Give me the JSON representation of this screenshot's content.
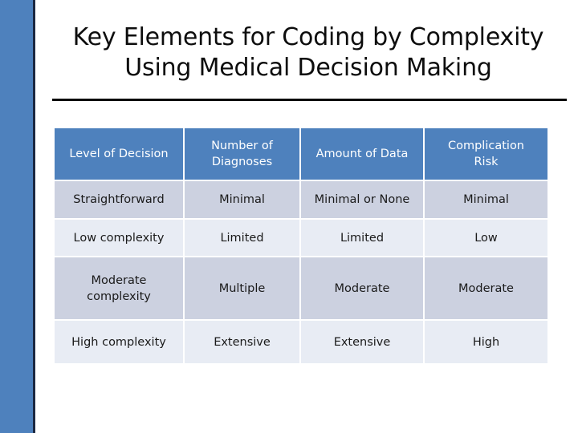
{
  "slide": {
    "title_line_1": "Key Elements for Coding by Complexity",
    "title_line_2": "Using Medical Decision Making",
    "accent_color": "#4e81bd",
    "accent_rule_color": "#1b2841",
    "title_rule_color": "#000000",
    "background_color": "#ffffff"
  },
  "table": {
    "header_fill": "#4e81bd",
    "header_text_color": "#ffffff",
    "row_fill_dark": "#ccd1e0",
    "row_fill_light": "#e8ecf4",
    "columns": [
      "Level of Decision",
      "Number of Diagnoses",
      "Amount of Data",
      "Complication Risk"
    ],
    "columns_wrapped": [
      [
        "Level of Decision"
      ],
      [
        "Number of",
        "Diagnoses"
      ],
      [
        "Amount of Data"
      ],
      [
        "Complication",
        "Risk"
      ]
    ],
    "rows": [
      {
        "level": "Straightforward",
        "diagnoses": "Minimal",
        "data": "Minimal or None",
        "risk": "Minimal"
      },
      {
        "level": "Low complexity",
        "diagnoses": "Limited",
        "data": "Limited",
        "risk": "Low"
      },
      {
        "level": "Moderate complexity",
        "level_wrapped": [
          "Moderate",
          "complexity"
        ],
        "diagnoses": "Multiple",
        "data": "Moderate",
        "risk": "Moderate"
      },
      {
        "level": "High complexity",
        "diagnoses": "Extensive",
        "data": "Extensive",
        "risk": "High"
      }
    ]
  }
}
